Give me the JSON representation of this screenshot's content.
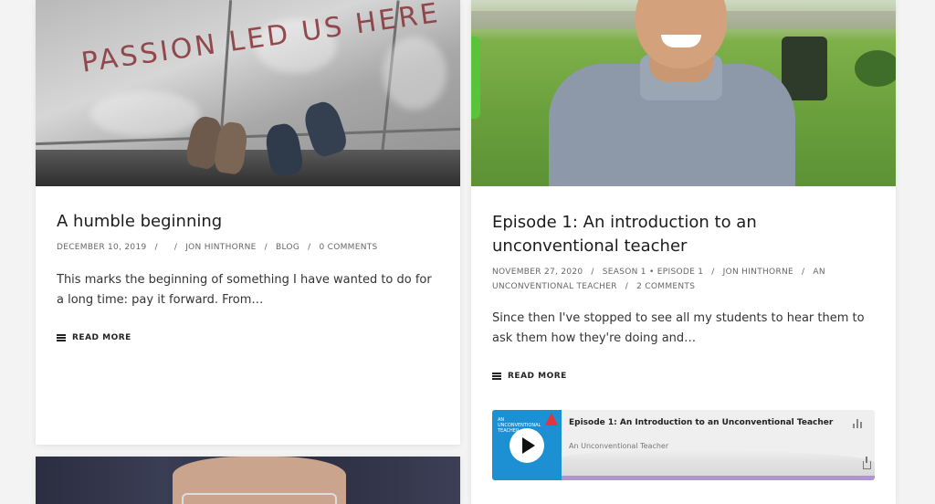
{
  "posts": [
    {
      "title": "A humble beginning",
      "image_text": "PASSION LED US HERE",
      "meta": {
        "date": "DECEMBER 10, 2019",
        "sep1": "/",
        "sep2": "/",
        "author": "JON HINTHORNE",
        "sep3": "/",
        "category": "BLOG",
        "sep4": "/",
        "comments": "0 COMMENTS"
      },
      "excerpt": "This marks the beginning of something I have wanted to do for a long time: pay it forward. From…",
      "read_more": "READ MORE"
    },
    {
      "title": "Episode 1: An introduction to an unconventional teacher",
      "meta": {
        "date": "NOVEMBER 27, 2020",
        "sep1": "/",
        "category_a": "SEASON 1",
        "dot": "•",
        "category_b": "EPISODE 1",
        "sep2": "/",
        "author": "JON HINTHORNE",
        "sep3": "/",
        "category_c": "AN UNCONVENTIONAL TEACHER",
        "sep4": "/",
        "comments": "2 COMMENTS"
      },
      "excerpt": "Since then I've stopped to see all my students to hear them to ask them how they're doing and…",
      "read_more": "READ MORE",
      "player": {
        "episode_title": "Episode 1: An Introduction to an Unconventional Teacher",
        "show_name": "An Unconventional Teacher",
        "cover_text": "AN UNCONVENTIONAL TEACHER",
        "progress": 0
      }
    }
  ]
}
